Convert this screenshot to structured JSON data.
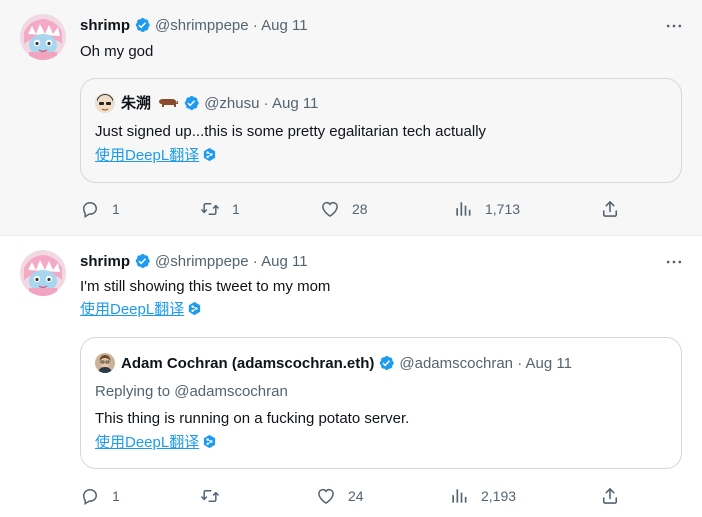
{
  "tweets": [
    {
      "author": {
        "name": "shrimp",
        "handle": "@shrimppepe"
      },
      "separator": "·",
      "date": "Aug 11",
      "text": "Oh my god",
      "quote": {
        "author": {
          "name": "朱溯",
          "handle": "@zhusu"
        },
        "date": "Aug 11",
        "text": "Just signed up...this is some pretty egalitarian tech actually",
        "translate": "使用DeepL翻译"
      },
      "stats": {
        "replies": "1",
        "reposts": "1",
        "likes": "28",
        "views": "1,713"
      }
    },
    {
      "author": {
        "name": "shrimp",
        "handle": "@shrimppepe"
      },
      "separator": "·",
      "date": "Aug 11",
      "text": "I'm still showing this tweet to my mom",
      "translate": "使用DeepL翻译",
      "quote": {
        "author": {
          "name": "Adam Cochran (adamscochran.eth)",
          "handle": "@adamscochran"
        },
        "date": "Aug 11",
        "replying_to": "Replying to @adamscochran",
        "text": "This thing is running on a fucking potato server.",
        "translate": "使用DeepL翻译"
      },
      "stats": {
        "replies": "1",
        "reposts": "",
        "likes": "24",
        "views": "2,193"
      }
    }
  ],
  "icons": {
    "verified": "verified-badge-icon",
    "more": "more-icon",
    "reply": "reply-icon",
    "repost": "repost-icon",
    "like": "heart-icon",
    "views": "views-icon",
    "share": "share-icon",
    "deepl": "deepl-icon"
  },
  "colors": {
    "accent": "#1d9bf0",
    "muted": "#536471",
    "border": "#cfd9de"
  }
}
